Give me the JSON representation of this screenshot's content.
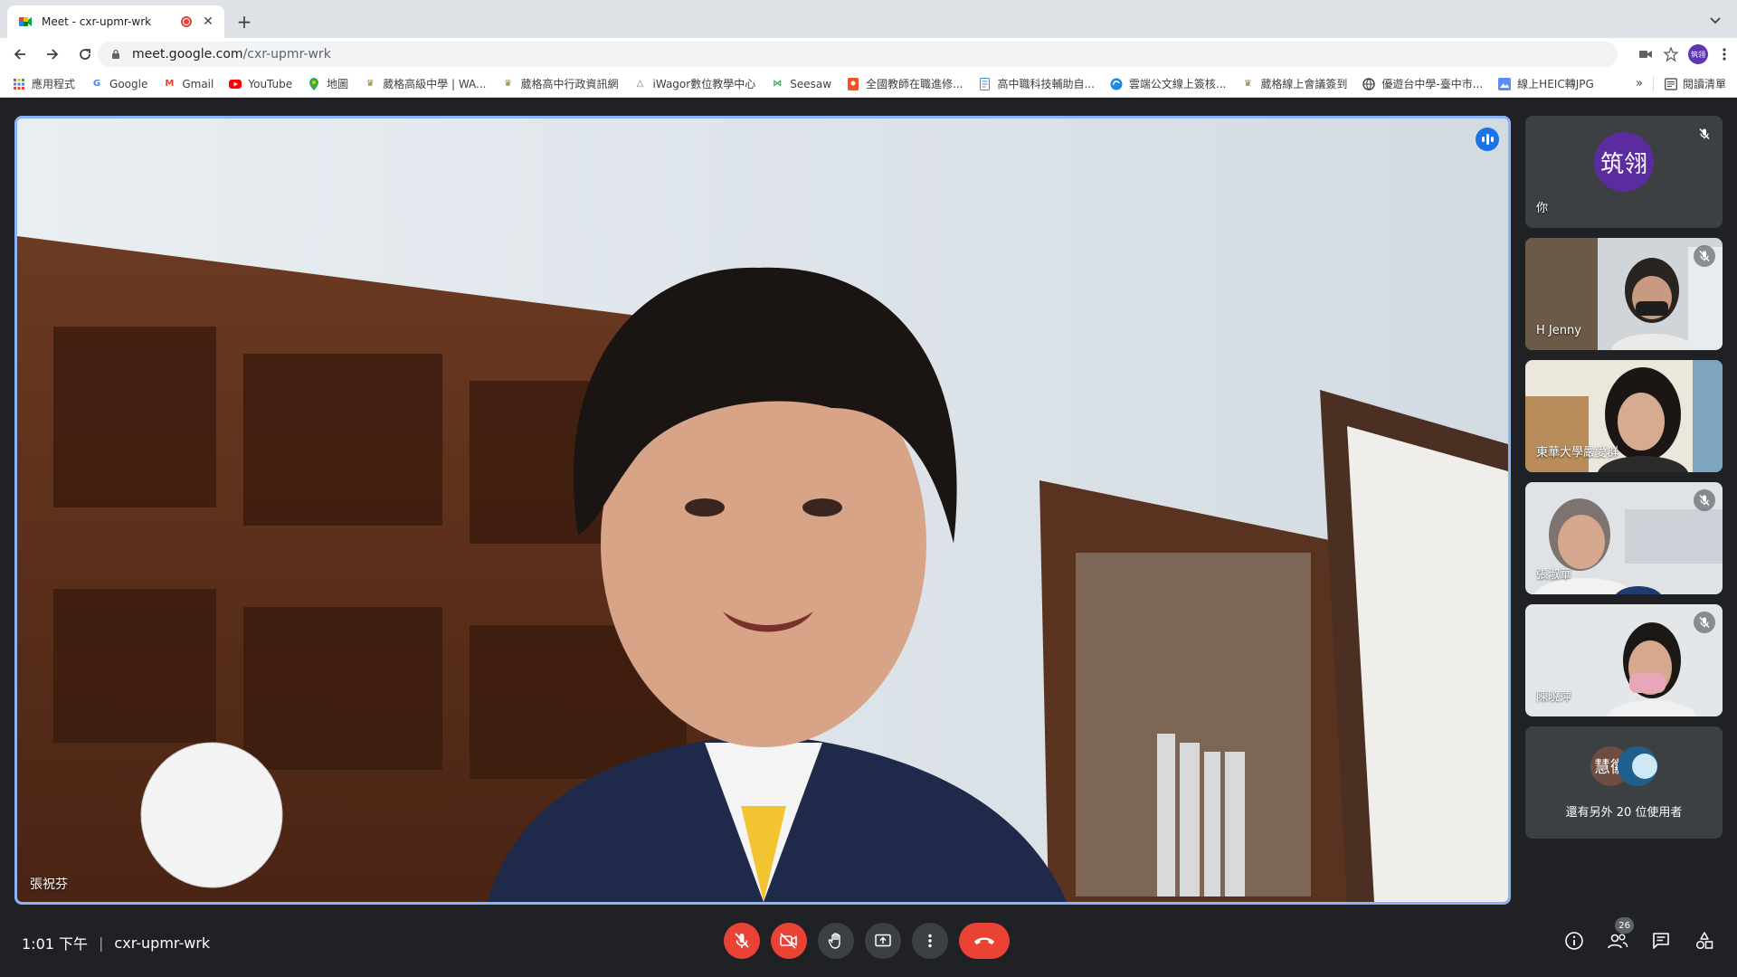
{
  "browser": {
    "tab": {
      "title": "Meet - cxr-upmr-wrk"
    },
    "new_tab_label": "+",
    "url": {
      "host": "meet.google.com",
      "path": "/cxr-upmr-wrk"
    },
    "profile_initials": "筑翎"
  },
  "bookmarks": {
    "items": [
      {
        "label": "應用程式",
        "icon": "apps-grid-icon"
      },
      {
        "label": "Google",
        "icon": "google-icon"
      },
      {
        "label": "Gmail",
        "icon": "gmail-icon"
      },
      {
        "label": "YouTube",
        "icon": "youtube-icon"
      },
      {
        "label": "地圖",
        "icon": "maps-pin-icon"
      },
      {
        "label": "葳格高級中學 | WA...",
        "icon": "school-crest-icon"
      },
      {
        "label": "葳格高中行政資訊網",
        "icon": "school-crest-icon"
      },
      {
        "label": "iWagor數位教學中心",
        "icon": "iwagor-icon"
      },
      {
        "label": "Seesaw",
        "icon": "seesaw-icon"
      },
      {
        "label": "全國教師在職進修...",
        "icon": "teacher-training-icon"
      },
      {
        "label": "高中職科技輔助自...",
        "icon": "document-icon"
      },
      {
        "label": "雲端公文線上簽核...",
        "icon": "cloud-doc-icon"
      },
      {
        "label": "葳格線上會議簽到",
        "icon": "school-crest-icon"
      },
      {
        "label": "優遊台中學-臺中市...",
        "icon": "globe-icon"
      },
      {
        "label": "線上HEIC轉JPG",
        "icon": "image-convert-icon"
      }
    ],
    "more_label": "»",
    "reading_list_label": "閱讀清單"
  },
  "meeting": {
    "main_speaker_name": "張祝芬",
    "self_label": "你",
    "self_avatar_text": "筑翎",
    "participants": [
      {
        "name": "H Jenny"
      },
      {
        "name": "東華大學嚴愛群"
      },
      {
        "name": "張淑華"
      },
      {
        "name": "陳曉萍"
      }
    ],
    "others_avatar_text": "慧徽",
    "others_label": "還有另外 20 位使用者",
    "time": "1:01 下午",
    "separator": "|",
    "code": "cxr-upmr-wrk",
    "participant_count": "26"
  },
  "colors": {
    "background": "#202124",
    "speaking_border": "#8ab4f8",
    "danger": "#ea4335",
    "self_avatar": "#5b2ca0"
  }
}
